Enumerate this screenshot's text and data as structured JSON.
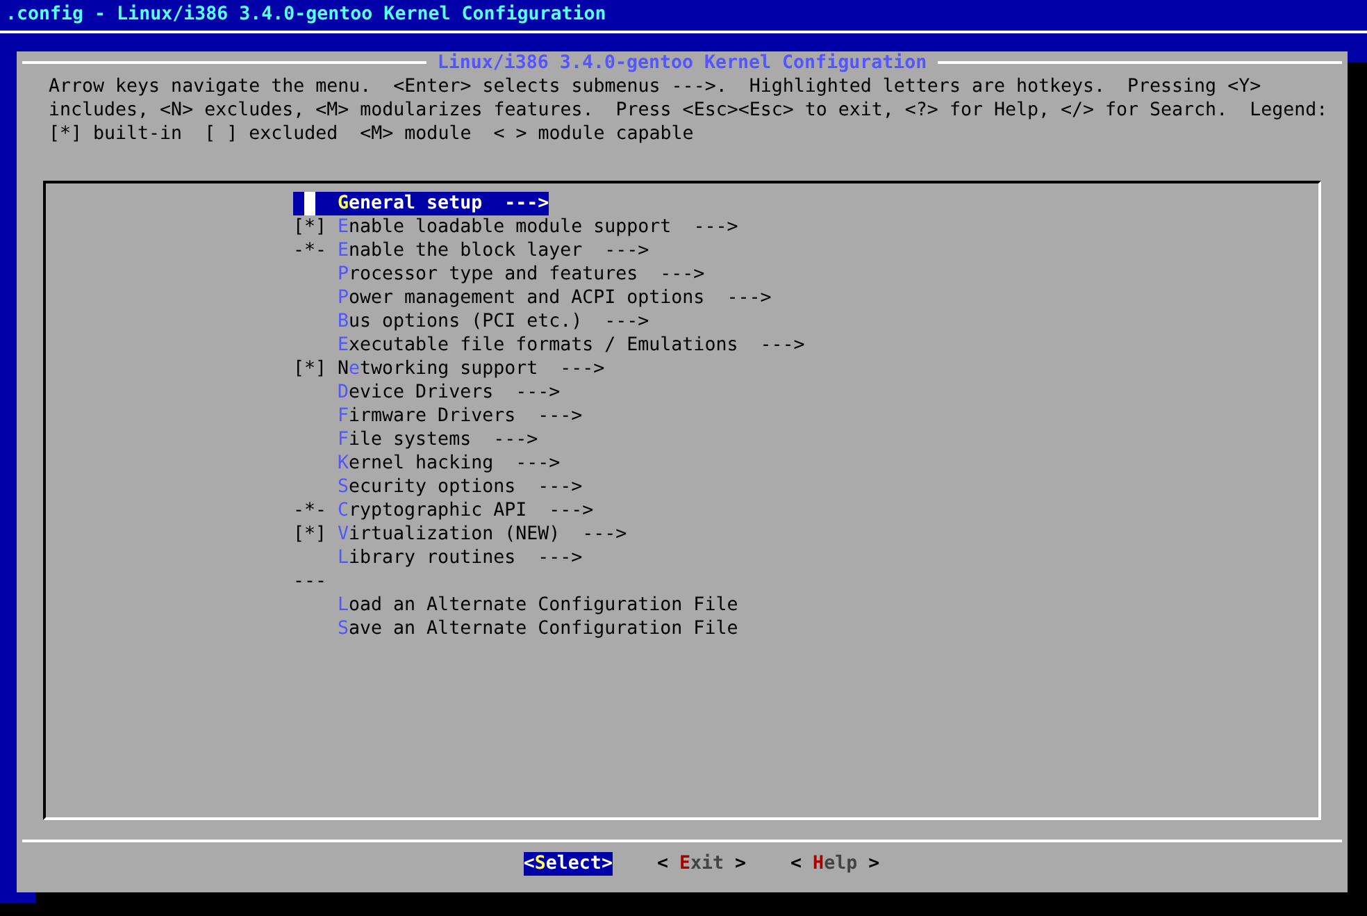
{
  "window": {
    "title": ".config - Linux/i386 3.4.0-gentoo Kernel Configuration"
  },
  "dialog": {
    "title": "Linux/i386 3.4.0-gentoo Kernel Configuration",
    "help_lines": [
      "Arrow keys navigate the menu.  <Enter> selects submenus --->.  Highlighted letters are hotkeys.  Pressing <Y>",
      "includes, <N> excludes, <M> modularizes features.  Press <Esc><Esc> to exit, <?> for Help, </> for Search.  Legend:",
      "[*] built-in  [ ] excluded  <M> module  < > module capable"
    ]
  },
  "menu": [
    {
      "kind": "item",
      "hotkey": "G",
      "after": "eneral setup",
      "arrow": "--->",
      "selected": true
    },
    {
      "kind": "item",
      "prefix": "[*]",
      "hotkey": "E",
      "after": "nable loadable module support",
      "arrow": "--->",
      "selected": false
    },
    {
      "kind": "item",
      "prefix": "-*-",
      "hotkey": "E",
      "after": "nable the block layer",
      "arrow": "--->",
      "selected": false
    },
    {
      "kind": "item",
      "hotkey": "P",
      "after": "rocessor type and features",
      "arrow": "--->",
      "selected": false
    },
    {
      "kind": "item",
      "hotkey": "P",
      "after": "ower management and ACPI options",
      "arrow": "--->",
      "selected": false
    },
    {
      "kind": "item",
      "hotkey": "B",
      "after": "us options (PCI etc.)",
      "arrow": "--->",
      "selected": false
    },
    {
      "kind": "item",
      "hotkey": "E",
      "after": "xecutable file formats / Emulations",
      "arrow": "--->",
      "selected": false
    },
    {
      "kind": "item",
      "prefix": "[*]",
      "before": "N",
      "hotkey": "e",
      "after": "tworking support",
      "arrow": "--->",
      "selected": false
    },
    {
      "kind": "item",
      "hotkey": "D",
      "after": "evice Drivers",
      "arrow": "--->",
      "selected": false
    },
    {
      "kind": "item",
      "hotkey": "F",
      "after": "irmware Drivers",
      "arrow": "--->",
      "selected": false
    },
    {
      "kind": "item",
      "hotkey": "F",
      "after": "ile systems",
      "arrow": "--->",
      "selected": false
    },
    {
      "kind": "item",
      "hotkey": "K",
      "after": "ernel hacking",
      "arrow": "--->",
      "selected": false
    },
    {
      "kind": "item",
      "hotkey": "S",
      "after": "ecurity options",
      "arrow": "--->",
      "selected": false
    },
    {
      "kind": "item",
      "prefix": "-*-",
      "hotkey": "C",
      "after": "ryptographic API",
      "arrow": "--->",
      "selected": false
    },
    {
      "kind": "item",
      "prefix": "[*]",
      "hotkey": "V",
      "after": "irtualization (NEW)",
      "arrow": "--->",
      "selected": false
    },
    {
      "kind": "item",
      "hotkey": "L",
      "after": "ibrary routines",
      "arrow": "--->",
      "selected": false
    },
    {
      "kind": "separator",
      "prefix": "---"
    },
    {
      "kind": "item",
      "hotkey": "L",
      "after": "oad an Alternate Configuration File",
      "selected": false
    },
    {
      "kind": "item",
      "hotkey": "S",
      "after": "ave an Alternate Configuration File",
      "selected": false
    }
  ],
  "buttons": [
    {
      "left": "<",
      "hotkey": "S",
      "rest": "elect",
      "right": ">",
      "selected": true
    },
    {
      "left": "< ",
      "hotkey": "E",
      "rest": "xit",
      "right": " >",
      "selected": false
    },
    {
      "left": "< ",
      "hotkey": "H",
      "rest": "elp",
      "right": " >",
      "selected": false
    }
  ]
}
